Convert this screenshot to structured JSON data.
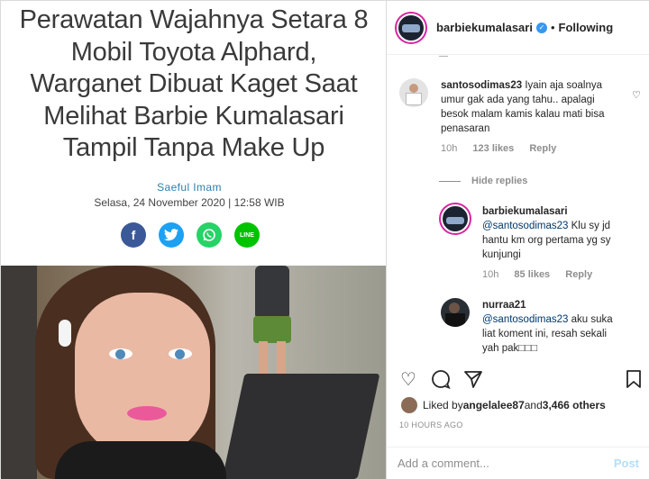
{
  "article": {
    "headline_lines": [
      "Perawatan Wajahnya Setara 8",
      "Mobil Toyota Alphard,",
      "Warganet Dibuat Kaget Saat",
      "Melihat Barbie Kumalasari",
      "Tampil Tanpa Make Up"
    ],
    "author": "Saeful Imam",
    "date": "Selasa, 24 November 2020 | 12:58 WIB",
    "share": {
      "facebook": "f",
      "twitter": "t",
      "whatsapp": "w",
      "line": "LINE"
    }
  },
  "instagram": {
    "header": {
      "username": "barbiekumalasari",
      "verified": "✓",
      "separator": "•",
      "follow_status": "Following"
    },
    "comments": [
      {
        "username": "santosodimas23",
        "text": "Iyain aja soalnya umur gak ada yang tahu.. apalagi besok malam kamis kalau mati bisa penasaran",
        "time": "10h",
        "likes": "123 likes",
        "reply": "Reply"
      }
    ],
    "hide_replies": "Hide replies",
    "replies": [
      {
        "username": "barbiekumalasari",
        "mention": "@santosodimas23",
        "text": " Klu sy jd hantu km org pertama yg sy kunjungi",
        "time": "10h",
        "likes": "85 likes",
        "reply": "Reply"
      },
      {
        "username": "nurraa21",
        "mention": "@santosodimas23",
        "text": " aku suka liat koment ini, resah sekali yah pak□□□"
      }
    ],
    "likes_line": {
      "prefix": "Liked by ",
      "user": "angelalee87",
      "middle": " and ",
      "count": "3,466 others"
    },
    "timestamp": "10 HOURS AGO",
    "add_comment_placeholder": "Add a comment...",
    "post_label": "Post"
  }
}
